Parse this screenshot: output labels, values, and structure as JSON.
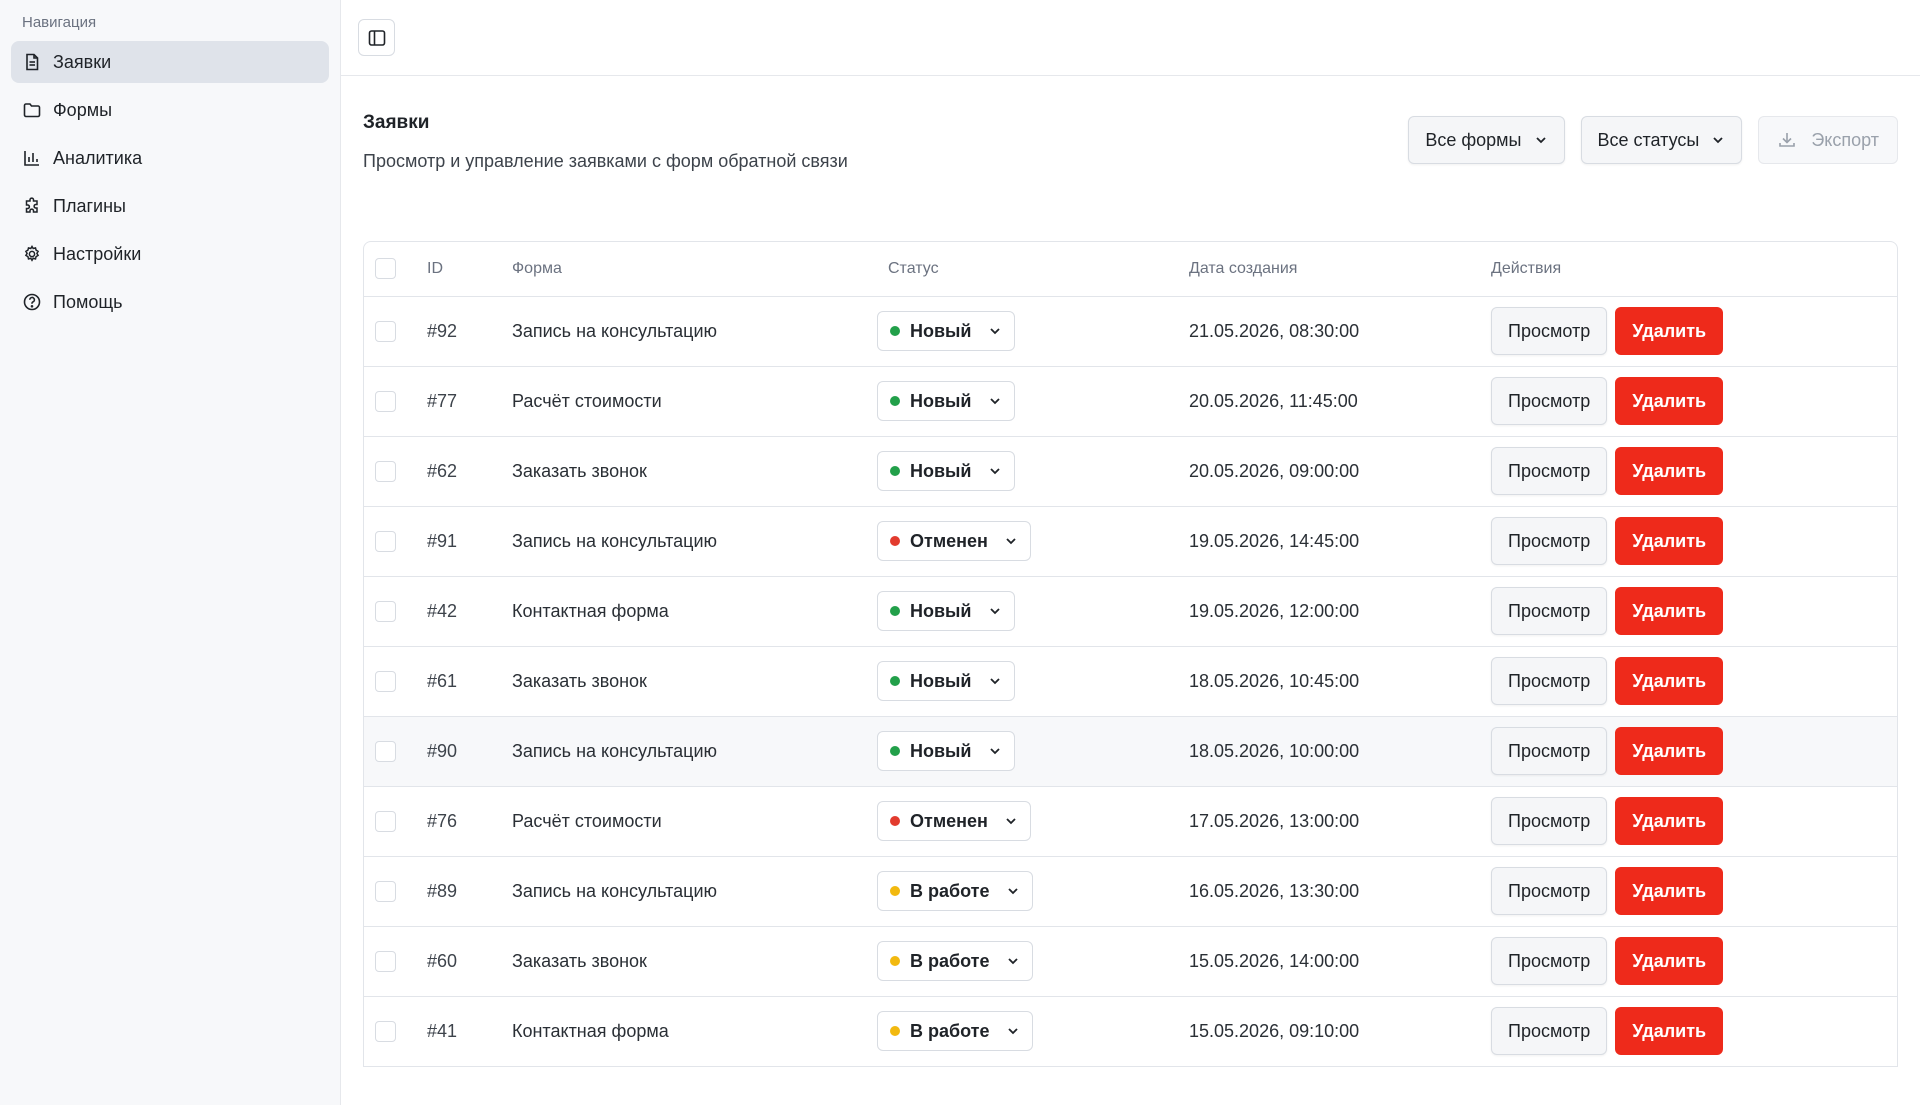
{
  "sidebar": {
    "heading": "Навигация",
    "items": [
      {
        "label": "Заявки",
        "icon": "document-icon",
        "active": true
      },
      {
        "label": "Формы",
        "icon": "folder-icon",
        "active": false
      },
      {
        "label": "Аналитика",
        "icon": "chart-icon",
        "active": false
      },
      {
        "label": "Плагины",
        "icon": "puzzle-icon",
        "active": false
      },
      {
        "label": "Настройки",
        "icon": "gear-icon",
        "active": false
      },
      {
        "label": "Помощь",
        "icon": "help-icon",
        "active": false
      }
    ]
  },
  "header": {
    "title": "Заявки",
    "subtitle": "Просмотр и управление заявками с форм обратной связи",
    "forms_filter": "Все формы",
    "status_filter": "Все статусы",
    "export_label": "Экспорт"
  },
  "table": {
    "columns": [
      "ID",
      "Форма",
      "Статус",
      "Дата создания",
      "Действия"
    ],
    "view_label": "Просмотр",
    "delete_label": "Удалить",
    "rows": [
      {
        "id": "#92",
        "form": "Запись на консультацию",
        "status": "Новый",
        "status_color": "#22a04a",
        "date": "21.05.2026, 08:30:00"
      },
      {
        "id": "#77",
        "form": "Расчёт стоимости",
        "status": "Новый",
        "status_color": "#22a04a",
        "date": "20.05.2026, 11:45:00"
      },
      {
        "id": "#62",
        "form": "Заказать звонок",
        "status": "Новый",
        "status_color": "#22a04a",
        "date": "20.05.2026, 09:00:00"
      },
      {
        "id": "#91",
        "form": "Запись на консультацию",
        "status": "Отменен",
        "status_color": "#e23b2e",
        "date": "19.05.2026, 14:45:00"
      },
      {
        "id": "#42",
        "form": "Контактная форма",
        "status": "Новый",
        "status_color": "#22a04a",
        "date": "19.05.2026, 12:00:00"
      },
      {
        "id": "#61",
        "form": "Заказать звонок",
        "status": "Новый",
        "status_color": "#22a04a",
        "date": "18.05.2026, 10:45:00"
      },
      {
        "id": "#90",
        "form": "Запись на консультацию",
        "status": "Новый",
        "status_color": "#22a04a",
        "date": "18.05.2026, 10:00:00",
        "hover": true
      },
      {
        "id": "#76",
        "form": "Расчёт стоимости",
        "status": "Отменен",
        "status_color": "#e23b2e",
        "date": "17.05.2026, 13:00:00"
      },
      {
        "id": "#89",
        "form": "Запись на консультацию",
        "status": "В работе",
        "status_color": "#f2b90f",
        "date": "16.05.2026, 13:30:00"
      },
      {
        "id": "#60",
        "form": "Заказать звонок",
        "status": "В работе",
        "status_color": "#f2b90f",
        "date": "15.05.2026, 14:00:00"
      },
      {
        "id": "#41",
        "form": "Контактная форма",
        "status": "В работе",
        "status_color": "#f2b90f",
        "date": "15.05.2026, 09:10:00"
      }
    ]
  }
}
